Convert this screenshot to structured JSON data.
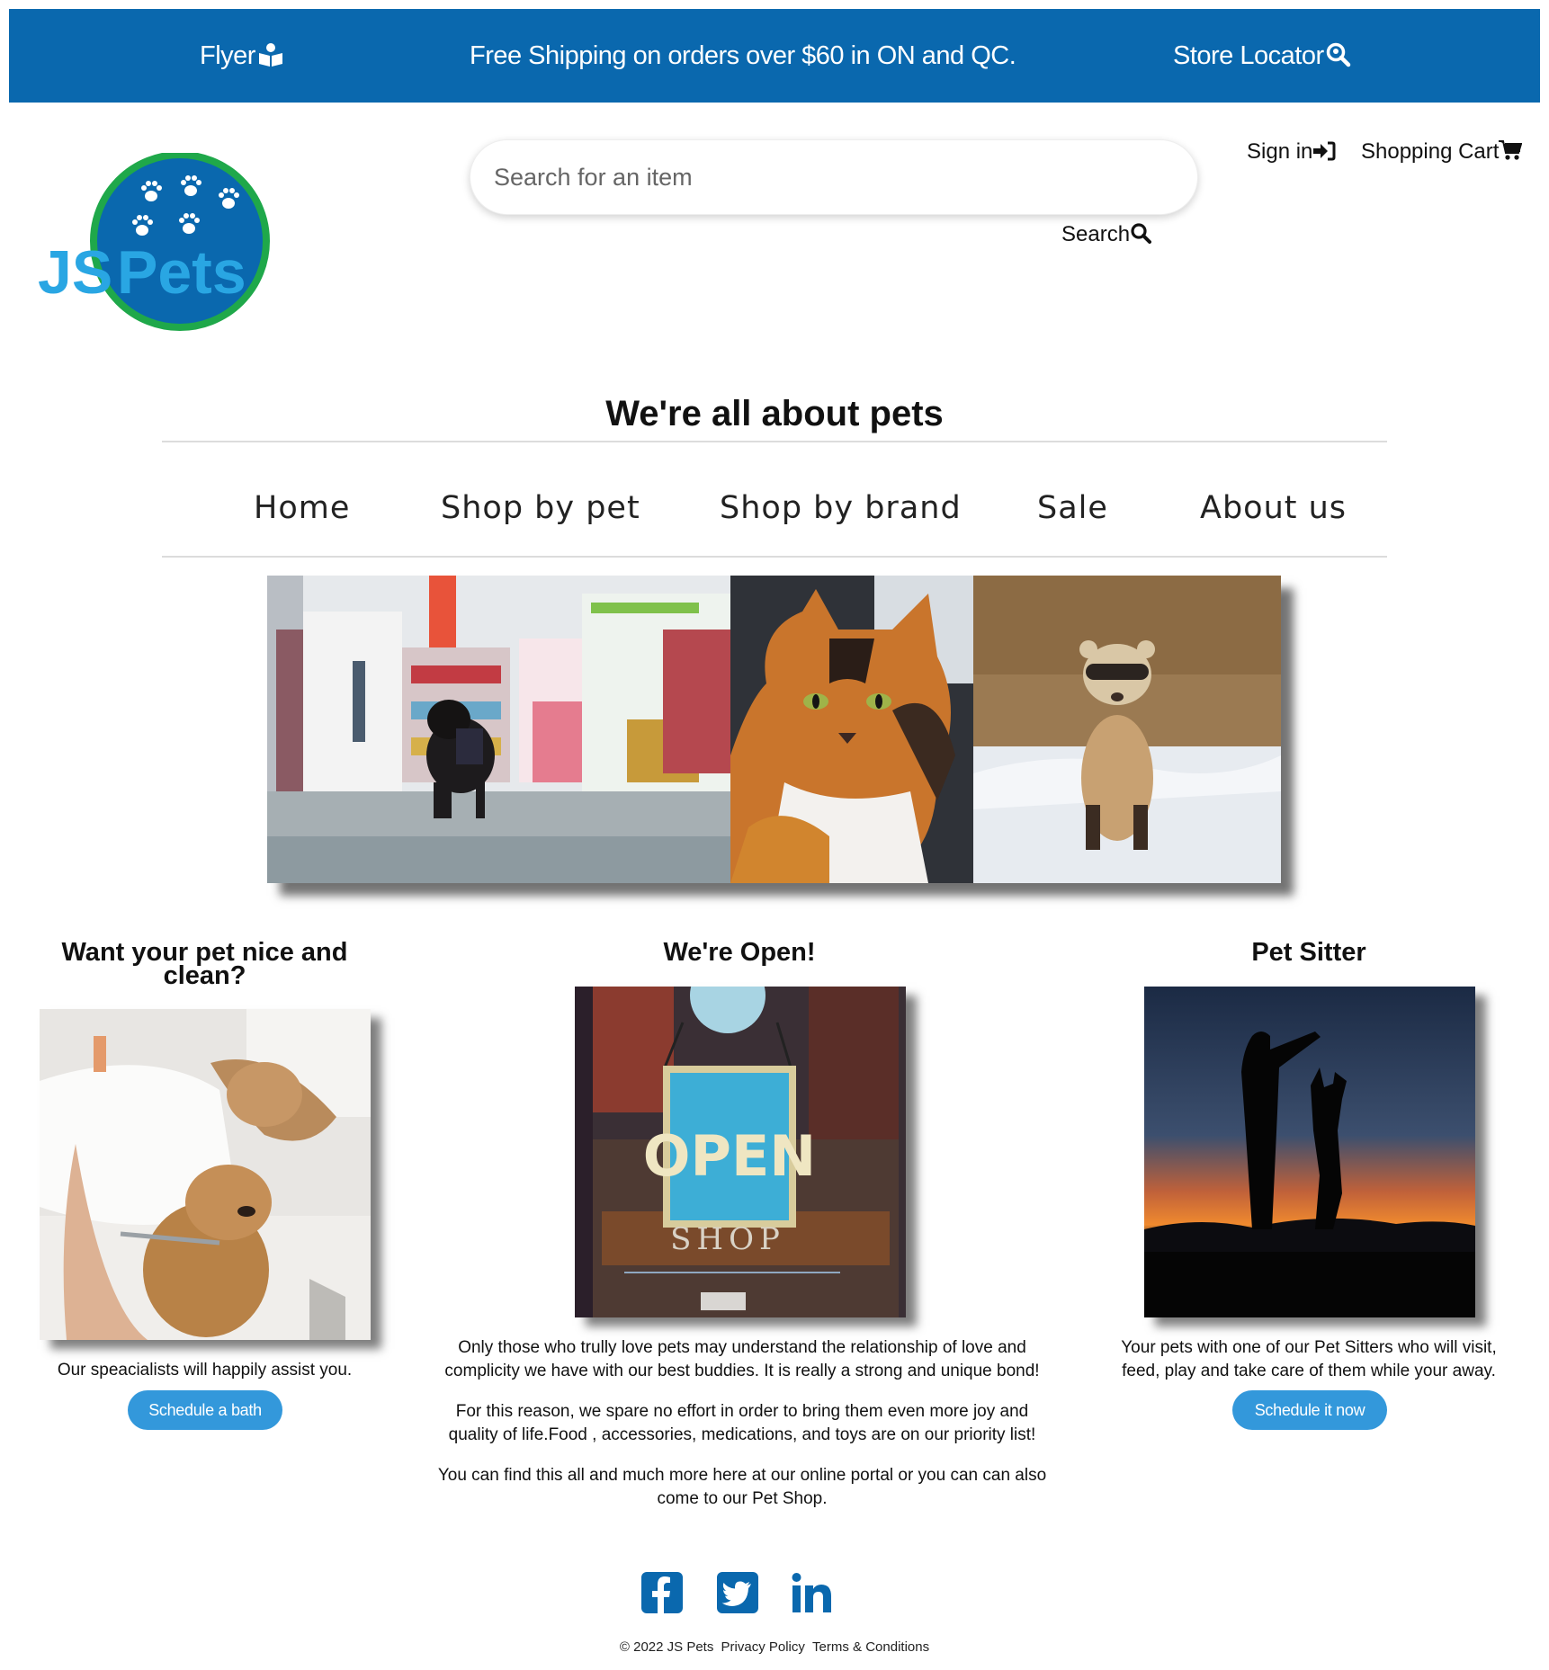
{
  "topbar": {
    "flyer": "Flyer",
    "shipping": "Free Shipping on orders over $60 in ON and QC.",
    "store_locator": "Store Locator",
    "background": "#0a68ae"
  },
  "logo": {
    "text_js": "JS",
    "text_pets": "Pets"
  },
  "search": {
    "placeholder": "Search for an item",
    "button_label": "Search"
  },
  "account": {
    "sign_in": "Sign in",
    "cart": "Shopping Cart"
  },
  "tagline": "We're all about pets",
  "nav": {
    "home": "Home",
    "shop_by_pet": "Shop by pet",
    "shop_by_brand": "Shop by brand",
    "sale": "Sale",
    "about_us": "About us"
  },
  "columns": {
    "bath": {
      "title_line1": "Want your pet nice and",
      "title_line2": "clean?",
      "text": "Our speacialists will happily assist you.",
      "button": "Schedule a bath"
    },
    "open": {
      "title": "We're Open!",
      "sign_open": "OPEN",
      "sign_shop": "SHOP",
      "p1_line1": "Only those who trully love pets may understand the relationship of love and",
      "p1_line2": "complicity we have with our best buddies. It is really a strong and unique bond!",
      "p2_line1": "For this reason, we spare no effort in order to bring them even more joy and",
      "p2_line2": "quality of life.Food , accessories, medications, and toys are on our priority list!",
      "p3_line1": "You can find this all and much more here at our online portal or you can can also",
      "p3_line2": "come to our Pet Shop."
    },
    "sitter": {
      "title": "Pet Sitter",
      "text_line1": "Your pets with one of our Pet Sitters who will visit,",
      "text_line2": "feed, play and take care of them while your away.",
      "button": "Schedule it now"
    }
  },
  "social": [
    "facebook-icon",
    "twitter-icon",
    "linkedin-icon"
  ],
  "footer": {
    "copyright": "© 2022 JS Pets",
    "privacy": "Privacy Policy",
    "terms": "Terms & Conditions"
  },
  "colors": {
    "brand_blue": "#0a68ae",
    "button_blue": "#3398db",
    "logo_green": "#1fa84a"
  }
}
